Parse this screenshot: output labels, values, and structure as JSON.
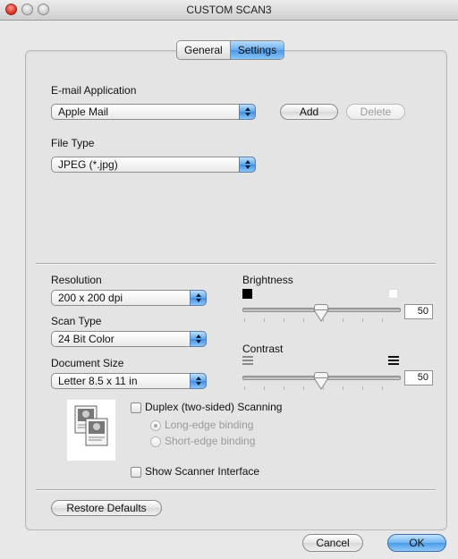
{
  "window": {
    "title": "CUSTOM SCAN3"
  },
  "tabs": [
    {
      "label": "General",
      "selected": false
    },
    {
      "label": "Settings",
      "selected": true
    }
  ],
  "email": {
    "label": "E-mail Application",
    "selected": "Apple Mail",
    "add_label": "Add",
    "delete_label": "Delete"
  },
  "file_type": {
    "label": "File Type",
    "selected": "JPEG (*.jpg)"
  },
  "resolution": {
    "label": "Resolution",
    "selected": "200 x 200 dpi"
  },
  "scan_type": {
    "label": "Scan Type",
    "selected": "24 Bit Color"
  },
  "document_size": {
    "label": "Document Size",
    "selected": "Letter  8.5 x 11 in"
  },
  "brightness": {
    "label": "Brightness",
    "value": "50"
  },
  "contrast": {
    "label": "Contrast",
    "value": "50"
  },
  "duplex": {
    "label": "Duplex (two-sided) Scanning",
    "long_edge": "Long-edge binding",
    "short_edge": "Short-edge binding"
  },
  "show_scanner_interface": {
    "label": "Show Scanner Interface"
  },
  "footer": {
    "restore_label": "Restore Defaults",
    "cancel_label": "Cancel",
    "ok_label": "OK"
  },
  "colors": {
    "accent": "#4b9ae8",
    "background": "#e8e8e8"
  },
  "icons": [
    "close-icon",
    "minimize-icon",
    "zoom-icon",
    "popup-arrow-icon",
    "brightness-dark-icon",
    "brightness-light-icon",
    "contrast-low-icon",
    "contrast-high-icon",
    "duplex-preview-icon"
  ]
}
